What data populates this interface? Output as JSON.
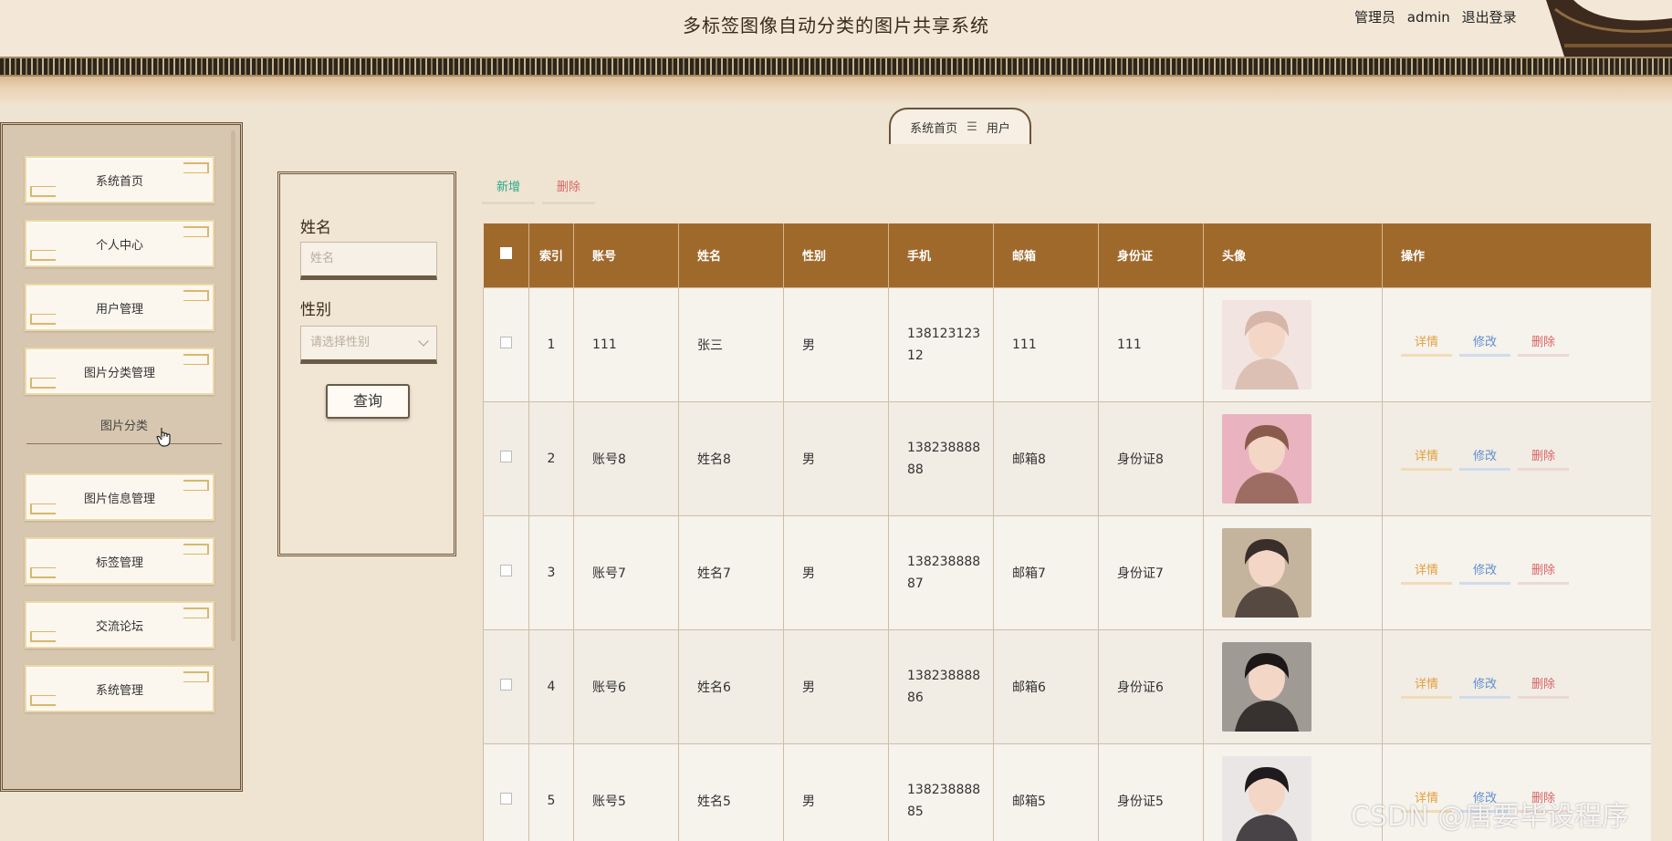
{
  "header": {
    "title": "多标签图像自动分类的图片共享系统",
    "role": "管理员",
    "username": "admin",
    "logout": "退出登录"
  },
  "sidebar": {
    "items": [
      {
        "label": "系统首页"
      },
      {
        "label": "个人中心"
      },
      {
        "label": "用户管理"
      },
      {
        "label": "图片分类管理"
      },
      {
        "label": "图片信息管理"
      },
      {
        "label": "标签管理"
      },
      {
        "label": "交流论坛"
      },
      {
        "label": "系统管理"
      }
    ],
    "submenu_label": "图片分类"
  },
  "breadcrumb": {
    "home": "系统首页",
    "separator": "☰",
    "current": "用户"
  },
  "search": {
    "name_label": "姓名",
    "name_placeholder": "姓名",
    "gender_label": "性别",
    "gender_placeholder": "请选择性别",
    "query_button": "查询"
  },
  "actions": {
    "add": "新增",
    "delete": "删除"
  },
  "table": {
    "headers": {
      "index": "索引",
      "account": "账号",
      "name": "姓名",
      "gender": "性别",
      "phone": "手机",
      "email": "邮箱",
      "idcard": "身份证",
      "avatar": "头像",
      "ops": "操作"
    },
    "op_labels": {
      "detail": "详情",
      "edit": "修改",
      "delete": "删除"
    },
    "rows": [
      {
        "index": "1",
        "account": "111",
        "name": "张三",
        "gender": "男",
        "phone": "13812312312",
        "email": "111",
        "idcard": "111"
      },
      {
        "index": "2",
        "account": "账号8",
        "name": "姓名8",
        "gender": "男",
        "phone": "13823888888",
        "email": "邮箱8",
        "idcard": "身份证8"
      },
      {
        "index": "3",
        "account": "账号7",
        "name": "姓名7",
        "gender": "男",
        "phone": "13823888887",
        "email": "邮箱7",
        "idcard": "身份证7"
      },
      {
        "index": "4",
        "account": "账号6",
        "name": "姓名6",
        "gender": "男",
        "phone": "13823888886",
        "email": "邮箱6",
        "idcard": "身份证6"
      },
      {
        "index": "5",
        "account": "账号5",
        "name": "姓名5",
        "gender": "男",
        "phone": "13823888885",
        "email": "邮箱5",
        "idcard": "身份证5"
      }
    ]
  },
  "watermark": "CSDN @唐要毕设程序",
  "colors": {
    "header_bg": "#a0692c",
    "add": "#2aa98c",
    "delete": "#d96565",
    "detail": "#e3a03c",
    "edit": "#5f8fcf"
  }
}
